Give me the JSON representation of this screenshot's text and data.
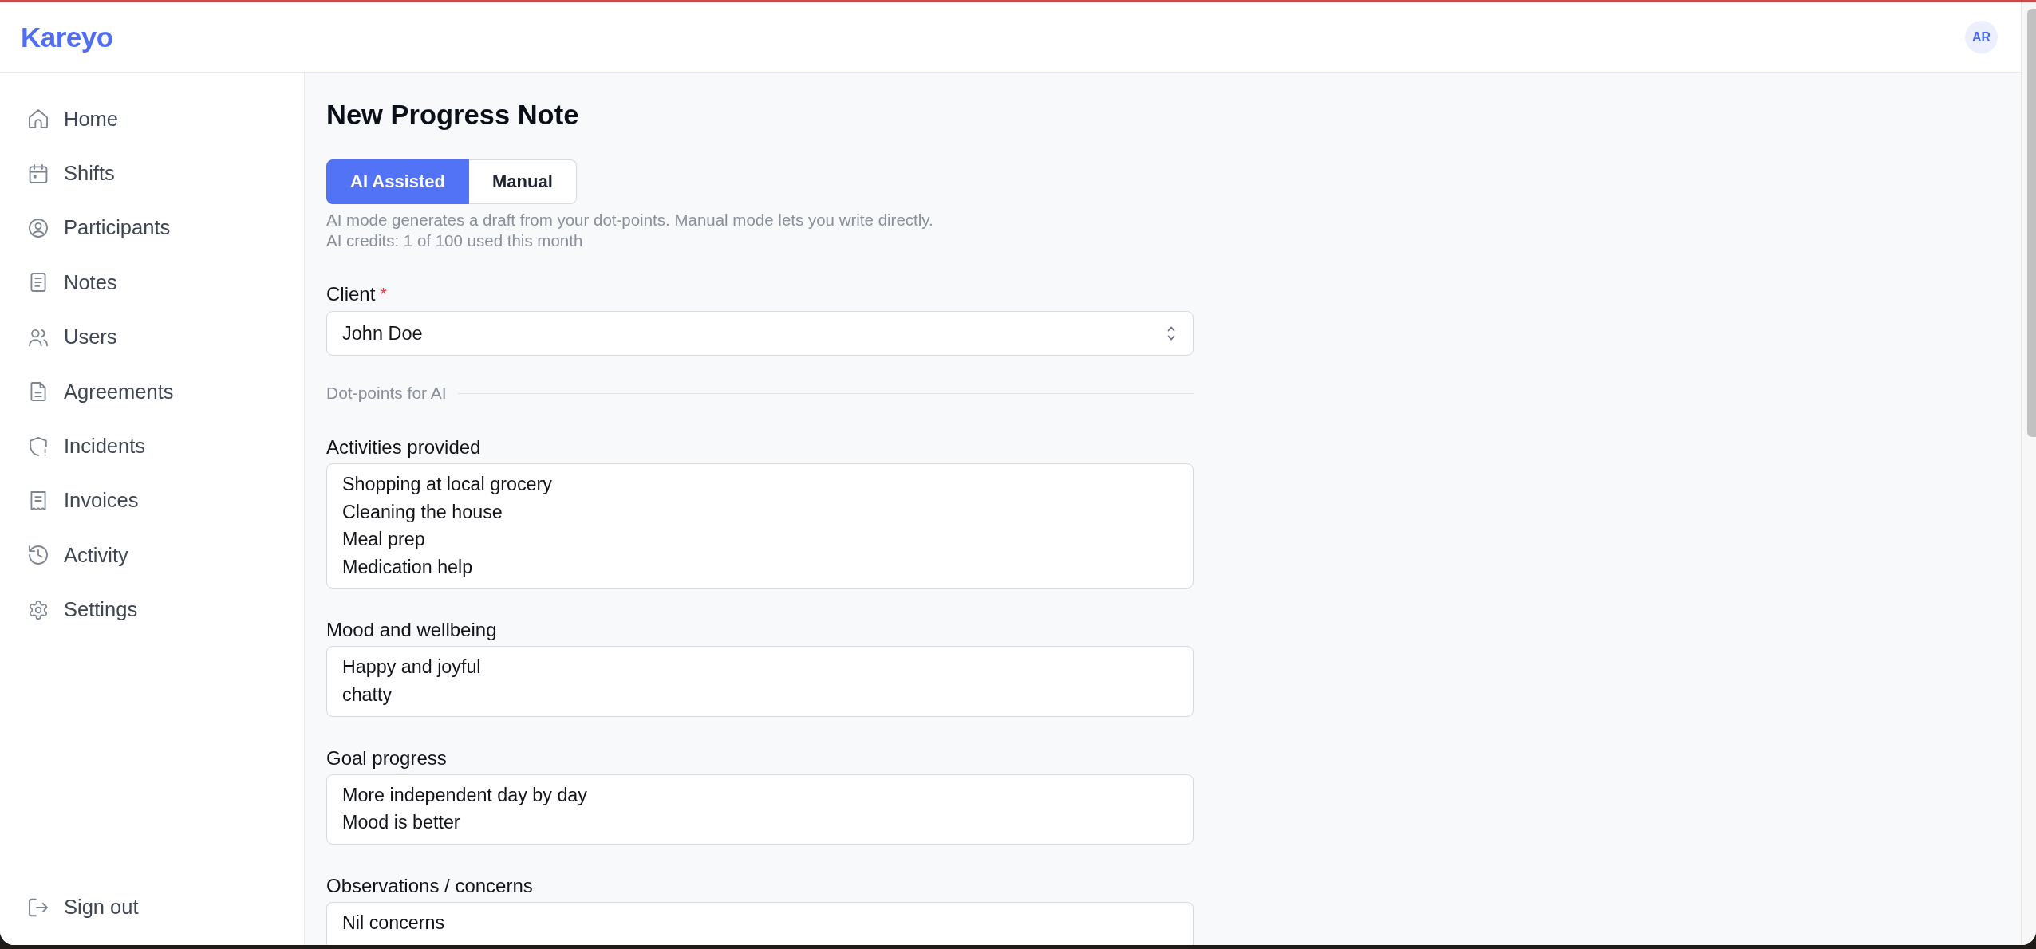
{
  "header": {
    "logo": "Kareyo",
    "avatar": "AR"
  },
  "sidebar": {
    "items": [
      {
        "label": "Home",
        "selected": false
      },
      {
        "label": "Shifts",
        "selected": false
      },
      {
        "label": "Participants",
        "selected": false
      },
      {
        "label": "Notes",
        "selected": false
      },
      {
        "label": "Users",
        "selected": false
      },
      {
        "label": "Agreements",
        "selected": false
      },
      {
        "label": "Incidents",
        "selected": false
      },
      {
        "label": "Invoices",
        "selected": false
      },
      {
        "label": "Activity",
        "selected": false
      },
      {
        "label": "Settings",
        "selected": false
      }
    ],
    "sign_out": "Sign out"
  },
  "page": {
    "title": "New Progress Note"
  },
  "mode_toggle": {
    "options": [
      {
        "label": "AI Assisted",
        "selected": true
      },
      {
        "label": "Manual",
        "selected": false
      }
    ],
    "hints": [
      "AI mode generates a draft from your dot-points. Manual mode lets you write directly.",
      "AI credits: 1 of 100 used this month"
    ]
  },
  "client": {
    "label": "Client",
    "required_mark": "*",
    "value": "John Doe"
  },
  "divider": {
    "label": "Dot-points for AI"
  },
  "fields": [
    {
      "label": "Activities provided",
      "value": "Shopping at local grocery\nCleaning the house\nMeal prep\nMedication help"
    },
    {
      "label": "Mood and wellbeing",
      "value": "Happy and joyful\nchatty"
    },
    {
      "label": "Goal progress",
      "value": "More independent day by day\nMood is better"
    },
    {
      "label": "Observations / concerns",
      "value": "Nil concerns"
    }
  ]
}
